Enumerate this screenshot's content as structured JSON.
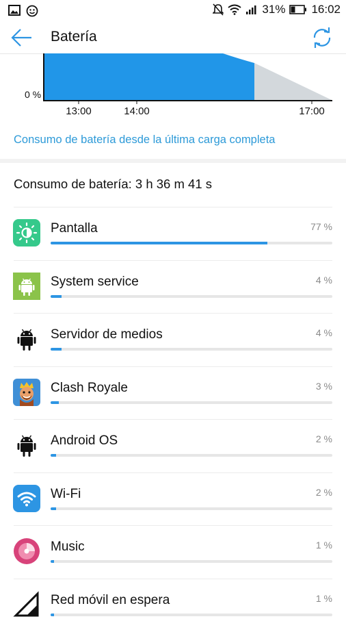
{
  "status_bar": {
    "battery_percent": "31%",
    "time": "16:02"
  },
  "header": {
    "title": "Batería",
    "back_icon": "arrow-left-icon",
    "refresh_icon": "refresh-icon"
  },
  "chart_data": {
    "type": "area",
    "y_label_zero": "0 %",
    "x_ticks": [
      "13:00",
      "14:00",
      "17:00"
    ],
    "fill_color": "#2196e8",
    "projection_color": "#d3d8dc"
  },
  "since_link": "Consumo de batería desde la última carga completa",
  "total_usage": "Consumo de batería: 3 h 36 m 41 s",
  "accent_color": "#2d95e3",
  "apps": [
    {
      "name": "Pantalla",
      "percent": "77 %",
      "fraction": 0.77,
      "icon": "screen-brightness-icon"
    },
    {
      "name": "System service",
      "percent": "4 %",
      "fraction": 0.04,
      "icon": "android-green-icon"
    },
    {
      "name": "Servidor de medios",
      "percent": "4 %",
      "fraction": 0.04,
      "icon": "android-black-icon"
    },
    {
      "name": "Clash Royale",
      "percent": "3 %",
      "fraction": 0.03,
      "icon": "clash-royale-icon"
    },
    {
      "name": "Android OS",
      "percent": "2 %",
      "fraction": 0.02,
      "icon": "android-black-icon"
    },
    {
      "name": "Wi-Fi",
      "percent": "2 %",
      "fraction": 0.02,
      "icon": "wifi-icon"
    },
    {
      "name": "Music",
      "percent": "1 %",
      "fraction": 0.01,
      "icon": "music-icon"
    },
    {
      "name": "Red móvil en espera",
      "percent": "1 %",
      "fraction": 0.01,
      "icon": "cellular-signal-icon"
    }
  ]
}
